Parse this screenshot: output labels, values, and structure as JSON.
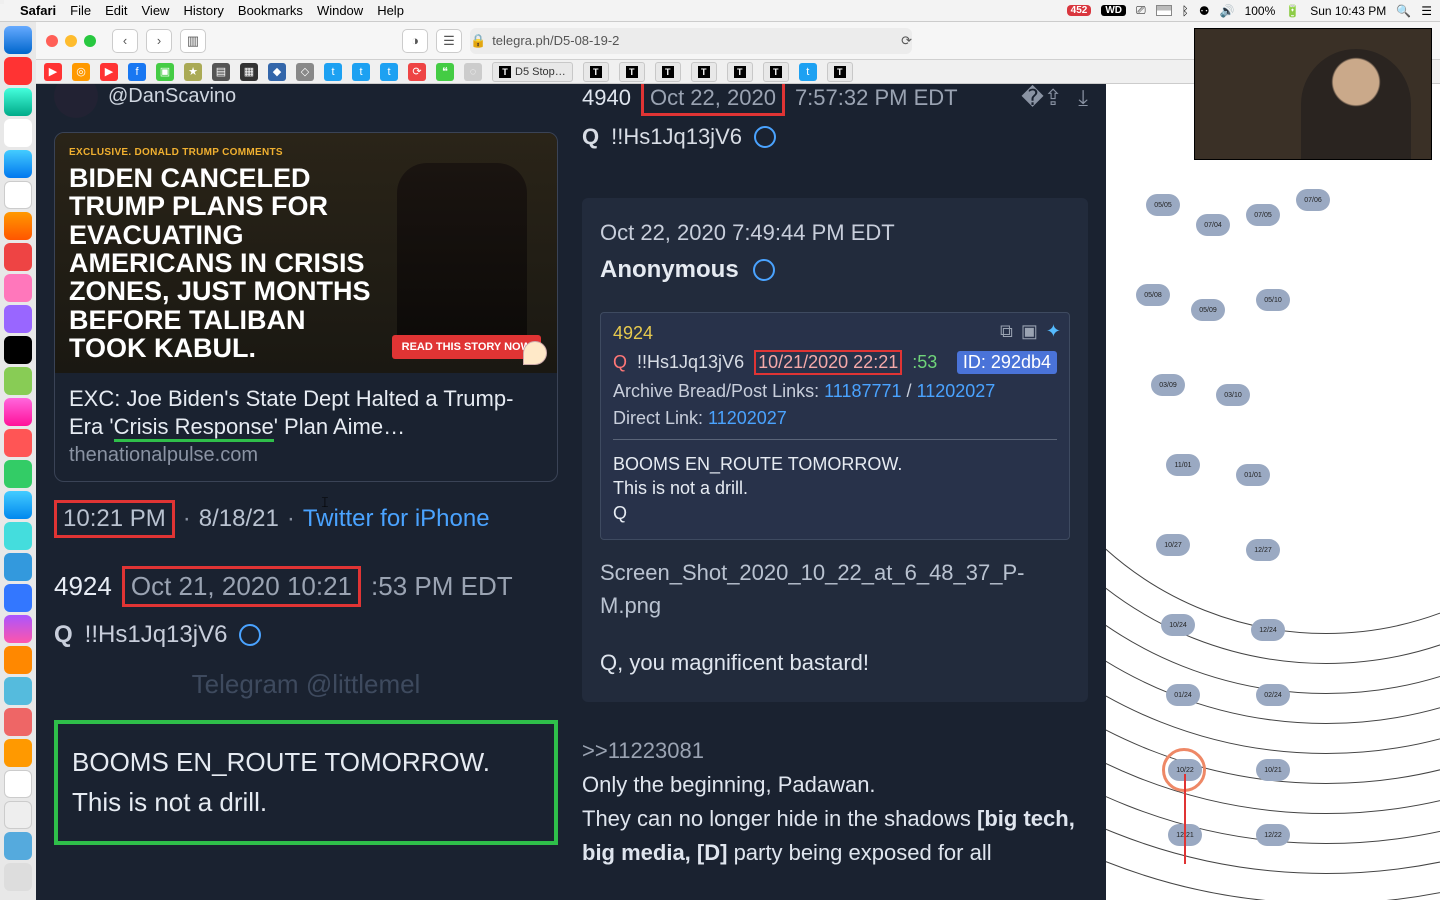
{
  "menubar": {
    "app": "Safari",
    "items": [
      "File",
      "Edit",
      "View",
      "History",
      "Bookmarks",
      "Window",
      "Help"
    ],
    "right": {
      "badge": "452",
      "wd": "WD",
      "battery": "100%",
      "clock": "Sun 10:43 PM"
    }
  },
  "toolbar": {
    "url": "telegra.ph/D5-08-19-2",
    "lock": "🔒"
  },
  "bookmarks_bar": {
    "tab_label": "D5 Stop…"
  },
  "left": {
    "handle": "@DanScavino",
    "card": {
      "exclusive": "EXCLUSIVE. DONALD TRUMP COMMENTS",
      "headline": "BIDEN CANCELED TRUMP PLANS FOR EVACUATING AMERICANS IN CRISIS ZONES, JUST MONTHS BEFORE TALIBAN TOOK KABUL.",
      "read": "READ THIS STORY NOW",
      "title_a": "EXC: Joe Biden's State Dept Halted a Trump-Era '",
      "title_u": "Crisis Response",
      "title_b": "' Plan Aime…",
      "source": "thenationalpulse.com"
    },
    "time": "10:21 PM",
    "date": "8/18/21",
    "via": "Twitter for iPhone",
    "post": {
      "num": "4924",
      "boxed": "Oct 21, 2020 10:21",
      "tail": ":53 PM EDT",
      "q": "Q",
      "trip": "!!Hs1Jq13jV6"
    },
    "watermark": "Telegram @littlemel",
    "green": {
      "l1": "BOOMS EN_ROUTE TOMORROW.",
      "l2": "This is not a drill."
    }
  },
  "right": {
    "topnum": "4940",
    "topdate": "Oct 22, 2020",
    "toptail": " 7:57:32 PM EDT",
    "q": "Q",
    "trip": "!!Hs1Jq13jV6",
    "quote": {
      "date": "Oct 22, 2020 7:49:44 PM EDT",
      "anon": "Anonymous",
      "inner": {
        "num": "4924",
        "q": "Q",
        "trip": "!!Hs1Jq13jV6",
        "dt": "10/21/2020 22:21",
        "sec": ":53",
        "id": "ID: 292db4",
        "arch_label": "Archive Bread/Post Links:",
        "arch_a": "11187771",
        "arch_sep": " / ",
        "arch_b": "11202027",
        "dl_label": "Direct Link:",
        "dl": "11202027",
        "l1": "BOOMS EN_ROUTE TOMORROW.",
        "l2": "This is not a drill.",
        "l3": "Q"
      },
      "fname": "Screen_Shot_2020_10_22_at_6_48_37_P-M.png",
      "magn": "Q, you magnificent bastard!"
    },
    "ref": {
      "num": ">>11223081",
      "l1": "Only the beginning, Padawan.",
      "l2a": "They can no longer hide in the shadows ",
      "l2b": "[big tech, big media, [D]",
      "l2c": " party being exposed for all"
    }
  },
  "clock_labels": [
    "10/22",
    "10/21",
    "12/21",
    "12/22",
    "10/27",
    "12/27",
    "11/01",
    "01/01",
    "05/05",
    "07/04",
    "07/05",
    "07/06",
    "05/08",
    "05/09",
    "05/10",
    "03/09",
    "03/10",
    "10/24",
    "12/24",
    "01/24",
    "02/24"
  ]
}
